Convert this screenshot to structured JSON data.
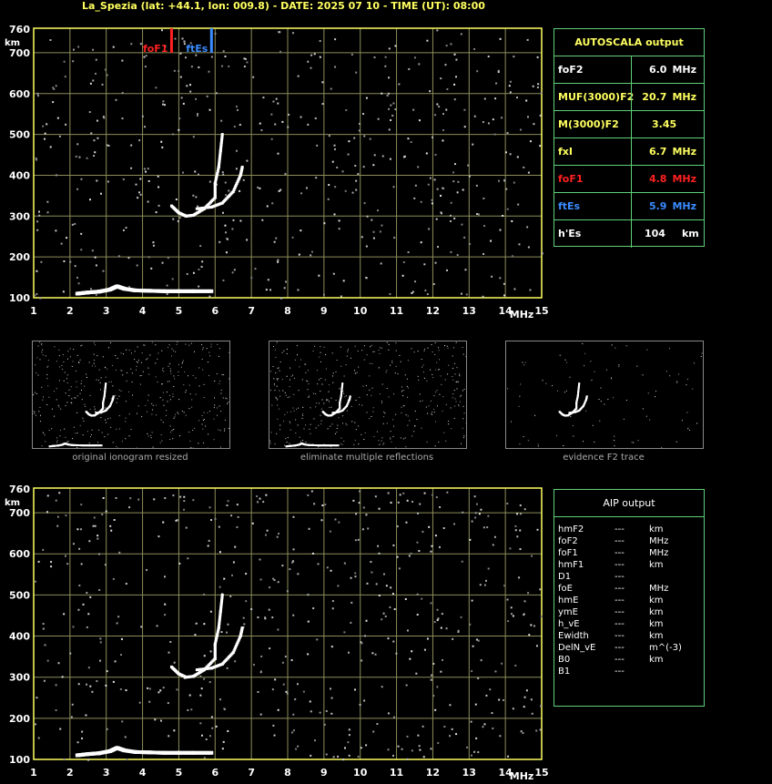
{
  "header": {
    "title": "La_Spezia (lat: +44.1, lon: 009.8) - DATE: 2025 07 10 - TIME (UT): 08:00"
  },
  "colors": {
    "grid": "#8c8c5a",
    "frame": "#ffff60",
    "foF1": "#ff2020",
    "ftEs": "#3a8cff",
    "panel_border": "#5fd07a"
  },
  "chart_data": [
    {
      "type": "scatter",
      "name_id": "ionogram-top",
      "x_ticks": [
        1,
        2,
        3,
        4,
        5,
        6,
        7,
        8,
        9,
        10,
        11,
        12,
        13,
        14,
        15
      ],
      "y_ticks": [
        100,
        200,
        300,
        400,
        500,
        600,
        700,
        760
      ],
      "x_unit": "MHz",
      "y_unit": "km",
      "xlim": [
        1,
        15
      ],
      "ylim": [
        100,
        760
      ],
      "grid": true,
      "markers": [
        {
          "label": "foF1",
          "freq": 4.8,
          "color": "#ff2020"
        },
        {
          "label": "ftEs",
          "freq": 5.9,
          "color": "#3a8cff"
        }
      ],
      "traces": {
        "E_layer": [
          [
            2.2,
            110
          ],
          [
            2.5,
            113
          ],
          [
            2.8,
            115
          ],
          [
            3.1,
            120
          ],
          [
            3.3,
            128
          ],
          [
            3.5,
            122
          ],
          [
            3.8,
            118
          ],
          [
            4.2,
            117
          ],
          [
            4.6,
            116
          ],
          [
            5.0,
            116
          ],
          [
            5.4,
            116
          ],
          [
            5.9,
            116
          ]
        ],
        "F1_ordinary": [
          [
            4.8,
            325
          ],
          [
            5.0,
            308
          ],
          [
            5.2,
            300
          ],
          [
            5.4,
            302
          ],
          [
            5.7,
            318
          ],
          [
            6.0,
            345
          ],
          [
            6.0,
            380
          ],
          [
            6.1,
            420
          ],
          [
            6.15,
            460
          ],
          [
            6.2,
            500
          ]
        ],
        "F2_extra": [
          [
            5.5,
            318
          ],
          [
            5.9,
            322
          ],
          [
            6.2,
            332
          ],
          [
            6.5,
            360
          ],
          [
            6.7,
            400
          ],
          [
            6.75,
            420
          ]
        ]
      }
    },
    {
      "type": "scatter",
      "name_id": "ionogram-bottom",
      "x_ticks": [
        1,
        2,
        3,
        4,
        5,
        6,
        7,
        8,
        9,
        10,
        11,
        12,
        13,
        14,
        15
      ],
      "y_ticks": [
        100,
        200,
        300,
        400,
        500,
        600,
        700,
        760
      ],
      "x_unit": "MHz",
      "y_unit": "km",
      "xlim": [
        1,
        15
      ],
      "ylim": [
        100,
        760
      ],
      "grid": true
    }
  ],
  "autoscala": {
    "title": "AUTOSCALA output",
    "rows": [
      {
        "label": "foF2",
        "value": "6.0",
        "unit": "MHz",
        "color": "#ffffff"
      },
      {
        "label": "MUF(3000)F2",
        "value": "20.7",
        "unit": "MHz",
        "color": "#ffff60"
      },
      {
        "label": "M(3000)F2",
        "value": "3.45",
        "unit": "",
        "color": "#ffff60"
      },
      {
        "label": "fxI",
        "value": "6.7",
        "unit": "MHz",
        "color": "#ffff60"
      },
      {
        "label": "foF1",
        "value": "4.8",
        "unit": "MHz",
        "color": "#ff2020"
      },
      {
        "label": "ftEs",
        "value": "5.9",
        "unit": "MHz",
        "color": "#3a8cff"
      },
      {
        "label": "h'Es",
        "value": "104",
        "unit": "km",
        "color": "#ffffff"
      }
    ]
  },
  "thumbnails": [
    {
      "caption": "original ionogram resized"
    },
    {
      "caption": "eliminate multiple reflections"
    },
    {
      "caption": "evidence F2 trace"
    }
  ],
  "aip": {
    "title": "AIP output",
    "rows": [
      {
        "label": "hmF2",
        "value": "---",
        "unit": "km"
      },
      {
        "label": "foF2",
        "value": "---",
        "unit": "MHz"
      },
      {
        "label": "foF1",
        "value": "---",
        "unit": "MHz"
      },
      {
        "label": "hmF1",
        "value": "---",
        "unit": "km"
      },
      {
        "label": "D1",
        "value": "---",
        "unit": ""
      },
      {
        "label": "foE",
        "value": "---",
        "unit": "MHz"
      },
      {
        "label": "hmE",
        "value": "---",
        "unit": "km"
      },
      {
        "label": "ymE",
        "value": "---",
        "unit": "km"
      },
      {
        "label": "h_vE",
        "value": "---",
        "unit": "km"
      },
      {
        "label": "Ewidth",
        "value": "---",
        "unit": "km"
      },
      {
        "label": "DelN_vE",
        "value": "---",
        "unit": "m^(-3)"
      },
      {
        "label": "B0",
        "value": "---",
        "unit": "km"
      },
      {
        "label": "B1",
        "value": "---",
        "unit": ""
      }
    ]
  }
}
